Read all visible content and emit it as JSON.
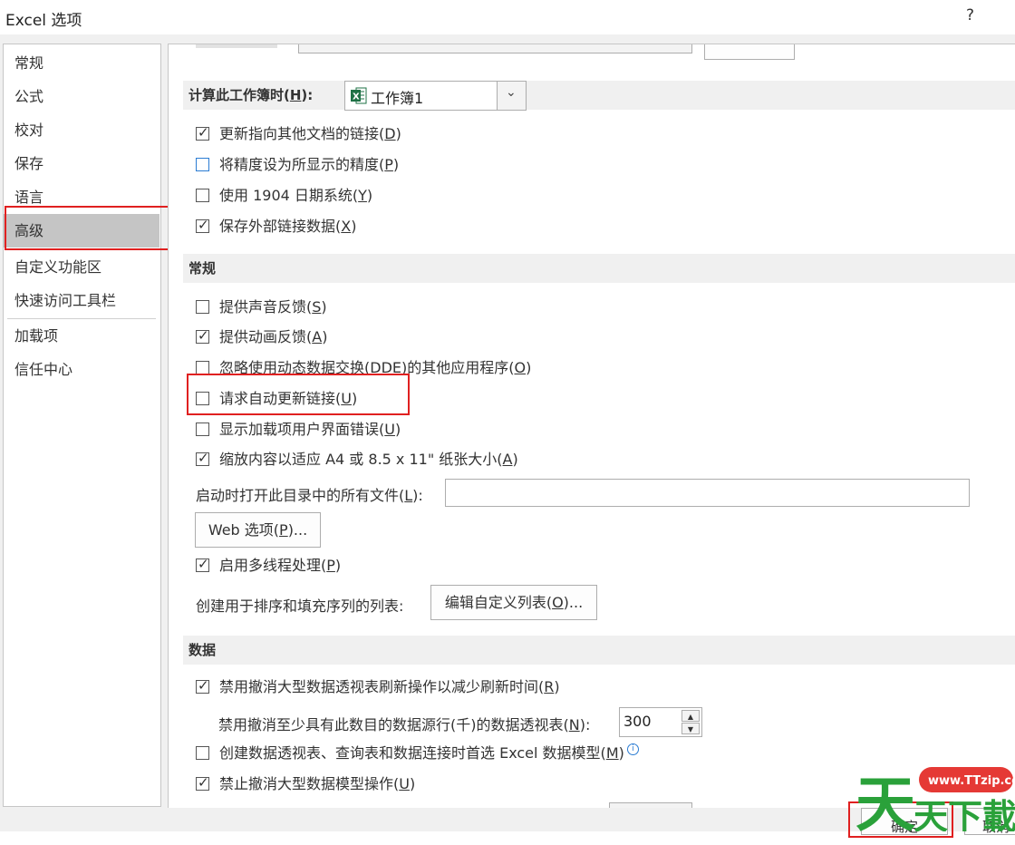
{
  "window": {
    "title": "Excel 选项",
    "help": "?"
  },
  "sidebar": {
    "items": [
      {
        "label": "常规"
      },
      {
        "label": "公式"
      },
      {
        "label": "校对"
      },
      {
        "label": "保存"
      },
      {
        "label": "语言"
      },
      {
        "label": "高级",
        "active": true
      },
      {
        "label": "自定义功能区"
      },
      {
        "label": "快速访问工具栏"
      },
      {
        "label": "加载项"
      },
      {
        "label": "信任中心"
      }
    ]
  },
  "calc_section": {
    "label_prefix": "计算此工作簿时(",
    "label_key": "H",
    "label_suffix": "):",
    "workbook": "工作簿1",
    "icon": "excel-workbook-icon"
  },
  "calc_options": [
    {
      "pre": "更新指向其他文档的链接(",
      "key": "D",
      "post": ")",
      "checked": true
    },
    {
      "pre": "将精度设为所显示的精度(",
      "key": "P",
      "post": ")",
      "checked": false
    },
    {
      "pre": "使用 1904 日期系统(",
      "key": "Y",
      "post": ")",
      "checked": false
    },
    {
      "pre": "保存外部链接数据(",
      "key": "X",
      "post": ")",
      "checked": true
    }
  ],
  "general": {
    "header": "常规",
    "options": [
      {
        "pre": "提供声音反馈(",
        "key": "S",
        "post": ")",
        "checked": false
      },
      {
        "pre": "提供动画反馈(",
        "key": "A",
        "post": ")",
        "checked": true
      },
      {
        "pre": "忽略使用动态数据交换(DDE)的其他应用程序(",
        "key": "O",
        "post": ")",
        "checked": false
      },
      {
        "pre": "请求自动更新链接(",
        "key": "U",
        "post": ")",
        "checked": false
      },
      {
        "pre": "显示加载项用户界面错误(",
        "key": "U",
        "post": ")",
        "checked": false
      },
      {
        "pre": "缩放内容以适应 A4 或 8.5 x 11\" 纸张大小(",
        "key": "A",
        "post": ")",
        "checked": true
      }
    ],
    "startup_label_pre": "启动时打开此目录中的所有文件(",
    "startup_label_key": "L",
    "startup_label_post": "):",
    "startup_value": "",
    "web_button_pre": "Web 选项(",
    "web_button_key": "P",
    "web_button_post": ")...",
    "multithread": {
      "pre": "启用多线程处理(",
      "key": "P",
      "post": ")",
      "checked": true
    },
    "custom_list_label": "创建用于排序和填充序列的列表:",
    "custom_list_button_pre": "编辑自定义列表(",
    "custom_list_button_key": "O",
    "custom_list_button_post": ")..."
  },
  "data": {
    "header": "数据",
    "disable_undo_large": {
      "pre": "禁用撤消大型数据透视表刷新操作以减少刷新时间(",
      "key": "R",
      "post": ")",
      "checked": true
    },
    "min_rows_label_pre": "禁用撤消至少具有此数目的数据源行(千)的数据透视表(",
    "min_rows_label_key": "N",
    "min_rows_label_post": "):",
    "min_rows_value": "300",
    "prefer_model": {
      "pre": "创建数据透视表、查询表和数据连接时首选 Excel 数据模型(",
      "key": "M",
      "post": ")",
      "checked": false
    },
    "disable_undo_model": {
      "pre": "禁止撤消大型数据模型操作(",
      "key": "U",
      "post": ")",
      "checked": true
    }
  },
  "footer": {
    "ok": "确定",
    "cancel": "取消"
  },
  "watermark": {
    "url": "www.TTzip.com",
    "text": "天下載"
  }
}
